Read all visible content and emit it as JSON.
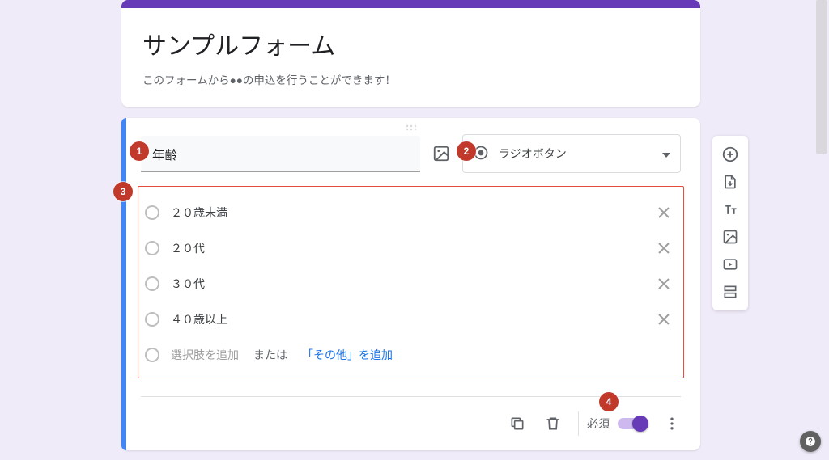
{
  "header": {
    "title": "サンプルフォーム",
    "description": "このフォームから●●の申込を行うことができます！"
  },
  "question": {
    "title": "年齢",
    "type_label": "ラジオボタン",
    "options": [
      {
        "label": "２０歳未満"
      },
      {
        "label": "２０代"
      },
      {
        "label": "３０代"
      },
      {
        "label": "４０歳以上"
      }
    ],
    "add_option_placeholder": "選択肢を追加",
    "or_text": "または",
    "add_other_label": "「その他」を追加",
    "required_label": "必須",
    "required_on": true
  },
  "callouts": {
    "one": "1",
    "two": "2",
    "three": "3",
    "four": "4"
  },
  "colors": {
    "accent": "#673ab7",
    "selection": "#4285f4",
    "callout": "#c0392b",
    "annotation_border": "#e74c3c"
  }
}
